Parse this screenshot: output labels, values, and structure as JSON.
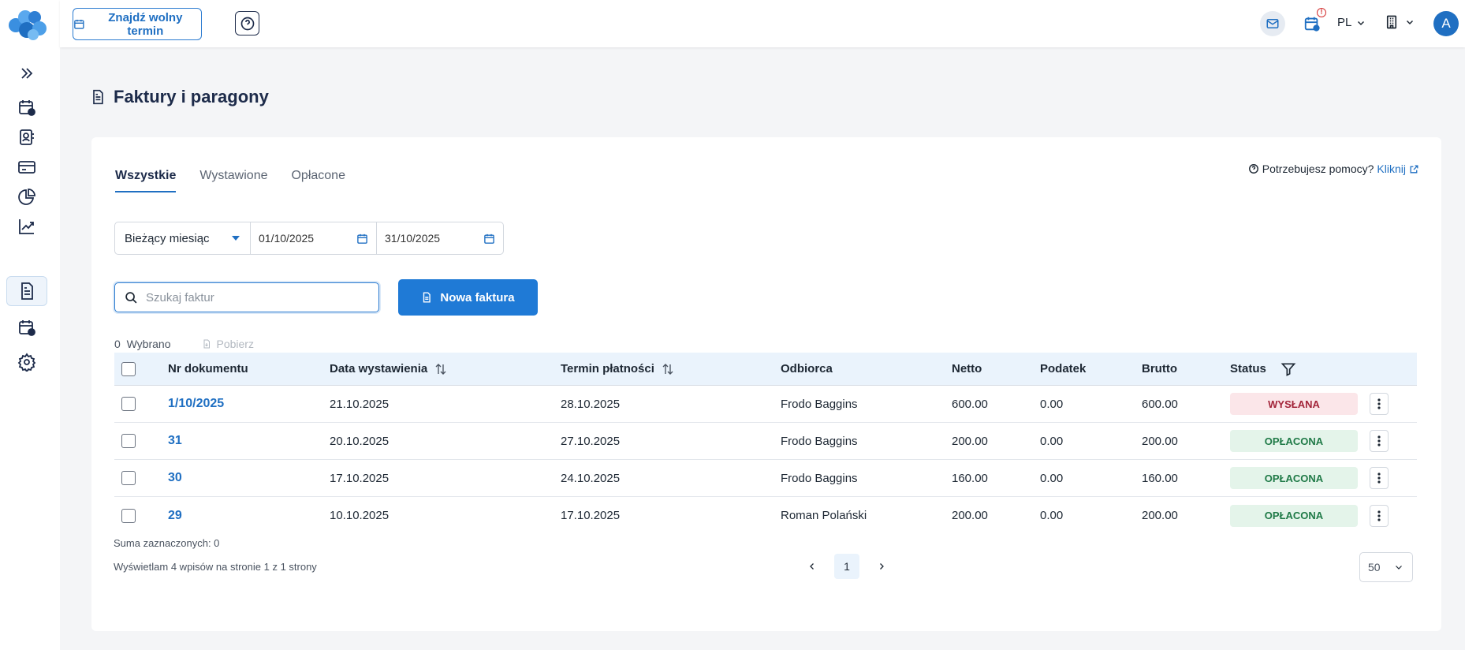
{
  "topbar": {
    "find_slot_label": "Znajdź wolny termin",
    "language": "PL",
    "avatar_initial": "A",
    "alert_mark": "!"
  },
  "page": {
    "title": "Faktury i paragony"
  },
  "tabs": [
    {
      "label": "Wszystkie",
      "active": true
    },
    {
      "label": "Wystawione",
      "active": false
    },
    {
      "label": "Opłacone",
      "active": false
    }
  ],
  "help": {
    "text": "Potrzebujesz pomocy?",
    "link": "Kliknij"
  },
  "filters": {
    "period": "Bieżący miesiąc",
    "date_from": "01/10/2025",
    "date_to": "31/10/2025"
  },
  "search": {
    "placeholder": "Szukaj faktur",
    "value": ""
  },
  "new_invoice_label": "Nowa faktura",
  "selection": {
    "count": "0",
    "label": "Wybrano",
    "download_label": "Pobierz"
  },
  "table": {
    "headers": {
      "nr": "Nr dokumentu",
      "date": "Data wystawienia",
      "term": "Termin płatności",
      "recipient": "Odbiorca",
      "net": "Netto",
      "tax": "Podatek",
      "gross": "Brutto",
      "status": "Status"
    },
    "rows": [
      {
        "nr": "1/10/2025",
        "date": "21.10.2025",
        "term": "28.10.2025",
        "recipient": "Frodo Baggins",
        "net": "600.00",
        "tax": "0.00",
        "gross": "600.00",
        "status": "WYSŁANA"
      },
      {
        "nr": "31",
        "date": "20.10.2025",
        "term": "27.10.2025",
        "recipient": "Frodo Baggins",
        "net": "200.00",
        "tax": "0.00",
        "gross": "200.00",
        "status": "OPŁACONA"
      },
      {
        "nr": "30",
        "date": "17.10.2025",
        "term": "24.10.2025",
        "recipient": "Frodo Baggins",
        "net": "160.00",
        "tax": "0.00",
        "gross": "160.00",
        "status": "OPŁACONA"
      },
      {
        "nr": "29",
        "date": "10.10.2025",
        "term": "17.10.2025",
        "recipient": "Roman Polański",
        "net": "200.00",
        "tax": "0.00",
        "gross": "200.00",
        "status": "OPŁACONA"
      }
    ]
  },
  "footer": {
    "sum_selected": "Suma zaznaczonych: 0",
    "showing": "Wyświetlam 4 wpisów na stronie 1 z 1 strony",
    "current_page": "1",
    "per_page": "50"
  },
  "colors": {
    "accent": "#1f7ad6",
    "sent_bg": "#fbe6e9",
    "paid_bg": "#e4f4ea"
  },
  "icons": [
    "expand-sidebar-icon",
    "calendar-clock-icon",
    "contacts-icon",
    "credit-card-icon",
    "pie-chart-icon",
    "trend-chart-icon",
    "invoice-icon",
    "calendar-user-icon",
    "gear-icon"
  ]
}
